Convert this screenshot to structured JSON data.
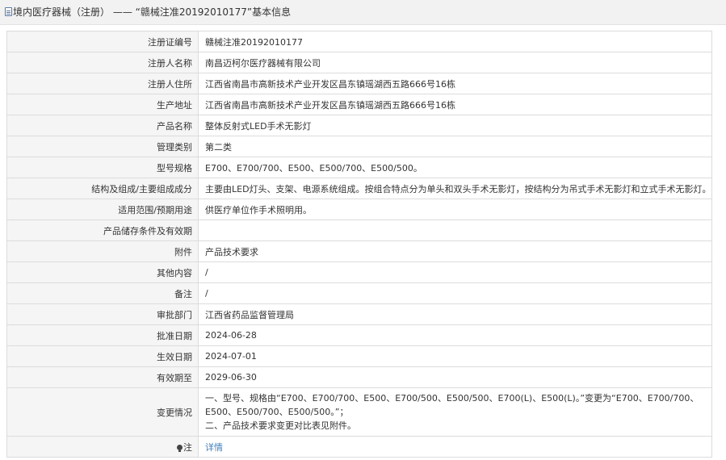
{
  "header": {
    "category": "境内医疗器械（注册）",
    "separator": "——",
    "title": "“赣械注准20192010177”基本信息"
  },
  "rows": [
    {
      "label": "注册证编号",
      "value": "赣械注准20192010177"
    },
    {
      "label": "注册人名称",
      "value": "南昌迈柯尔医疗器械有限公司"
    },
    {
      "label": "注册人住所",
      "value": "江西省南昌市高新技术产业开发区昌东镇瑶湖西五路666号16栋"
    },
    {
      "label": "生产地址",
      "value": "江西省南昌市高新技术产业开发区昌东镇瑶湖西五路666号16栋"
    },
    {
      "label": "产品名称",
      "value": "整体反射式LED手术无影灯"
    },
    {
      "label": "管理类别",
      "value": "第二类"
    },
    {
      "label": "型号规格",
      "value": "E700、E700/700、E500、E500/700、E500/500。"
    },
    {
      "label": "结构及组成/主要组成成分",
      "value": "主要由LED灯头、支架、电源系统组成。按组合特点分为单头和双头手术无影灯，按结构分为吊式手术无影灯和立式手术无影灯。"
    },
    {
      "label": "适用范围/预期用途",
      "value": "供医疗单位作手术照明用。"
    },
    {
      "label": "产品储存条件及有效期",
      "value": ""
    },
    {
      "label": "附件",
      "value": "产品技术要求"
    },
    {
      "label": "其他内容",
      "value": "/"
    },
    {
      "label": "备注",
      "value": "/"
    },
    {
      "label": "审批部门",
      "value": "江西省药品监督管理局"
    },
    {
      "label": "批准日期",
      "value": "2024-06-28"
    },
    {
      "label": "生效日期",
      "value": "2024-07-01"
    },
    {
      "label": "有效期至",
      "value": "2029-06-30"
    }
  ],
  "change": {
    "label": "变更情况",
    "line1": "一、型号、规格由“E700、E700/700、E500、E700/500、E500/500、E700(L)、E500(L)。”变更为“E700、E700/700、E500、E500/700、E500/500。”；",
    "line2": "二、产品技术要求变更对比表见附件。"
  },
  "note": {
    "label": "注",
    "link": "详情",
    "link_color": "#3d7fc1"
  },
  "icons": {
    "header": "document-icon",
    "note": "lightbulb-icon"
  }
}
